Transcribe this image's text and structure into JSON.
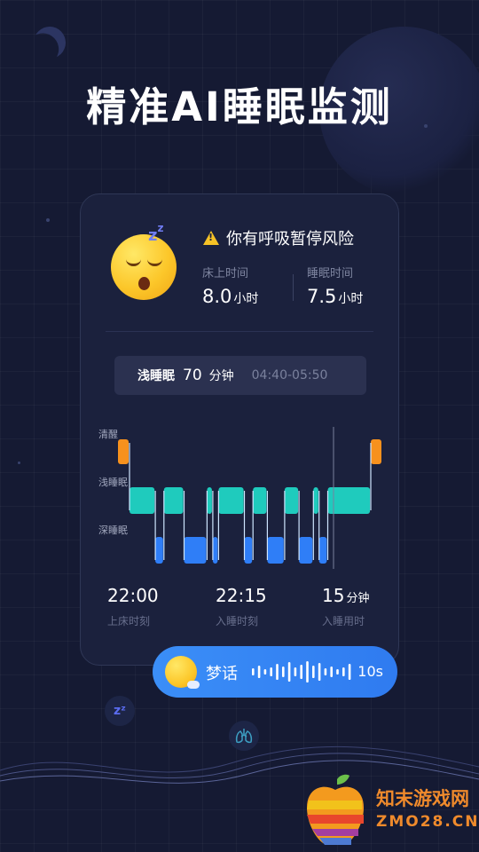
{
  "headline": "精准AI睡眠监测",
  "card": {
    "warning": "你有呼吸暂停风险",
    "bed_time": {
      "label": "床上时间",
      "value": "8.0",
      "unit": "小时"
    },
    "sleep_time": {
      "label": "睡眠时间",
      "value": "7.5",
      "unit": "小时"
    },
    "stage": {
      "name": "浅睡眠",
      "minutes": "70",
      "unit": "分钟",
      "range": "04:40-05:50"
    },
    "y_labels": {
      "awake": "清醒",
      "light": "浅睡眠",
      "deep": "深睡眠"
    },
    "bottom": [
      {
        "value": "22:00",
        "unit": "",
        "caption": "上床时刻"
      },
      {
        "value": "22:15",
        "unit": "",
        "caption": "入睡时刻"
      },
      {
        "value": "15",
        "unit": "分钟",
        "caption": "入睡用时"
      }
    ]
  },
  "chart_data": {
    "type": "step",
    "levels": [
      "清醒",
      "浅睡眠",
      "深睡眠"
    ],
    "segments": [
      {
        "stage": "awake",
        "length": 0.04
      },
      {
        "stage": "light",
        "length": 0.09
      },
      {
        "stage": "deep",
        "length": 0.03
      },
      {
        "stage": "light",
        "length": 0.07
      },
      {
        "stage": "deep",
        "length": 0.08
      },
      {
        "stage": "light",
        "length": 0.02
      },
      {
        "stage": "deep",
        "length": 0.02
      },
      {
        "stage": "light",
        "length": 0.09
      },
      {
        "stage": "deep",
        "length": 0.03
      },
      {
        "stage": "light",
        "length": 0.05
      },
      {
        "stage": "deep",
        "length": 0.06
      },
      {
        "stage": "light",
        "length": 0.05
      },
      {
        "stage": "deep",
        "length": 0.05
      },
      {
        "stage": "light",
        "length": 0.02
      },
      {
        "stage": "deep",
        "length": 0.03
      },
      {
        "stage": "light",
        "length": 0.15
      },
      {
        "stage": "awake",
        "length": 0.04
      }
    ],
    "colors": {
      "awake": "#f7911d",
      "light": "#1fcbbd",
      "deep": "#2f7ef7"
    }
  },
  "dream": {
    "label": "梦话",
    "duration": "10s"
  },
  "watermark": {
    "line1": "知末游戏网",
    "line2": "ZMO28.CN"
  }
}
